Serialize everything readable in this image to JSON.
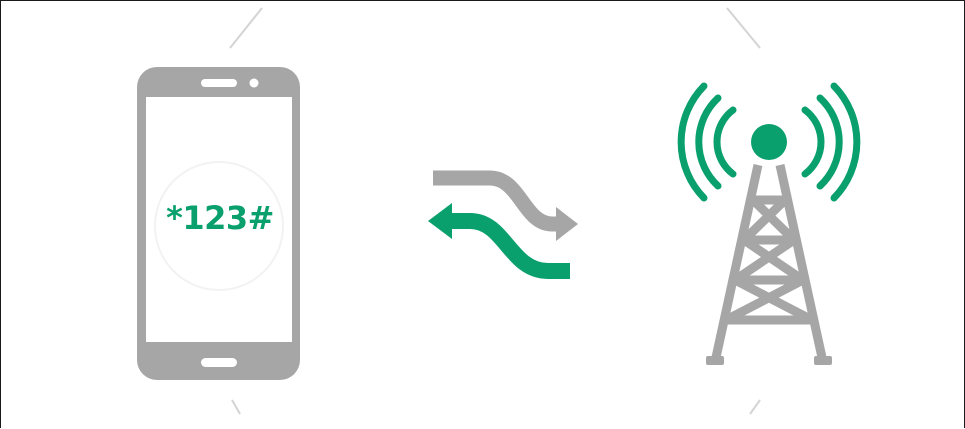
{
  "ussd_code": "*123#",
  "colors": {
    "gray": "#a6a6a6",
    "green": "#0aa06e",
    "screen_bg": "#ffffff",
    "faint_lines": "#d4d4d4"
  },
  "icons": {
    "phone": "smartphone-icon",
    "arrows": "two-way-transfer-arrows-icon",
    "tower": "signal-tower-icon"
  }
}
